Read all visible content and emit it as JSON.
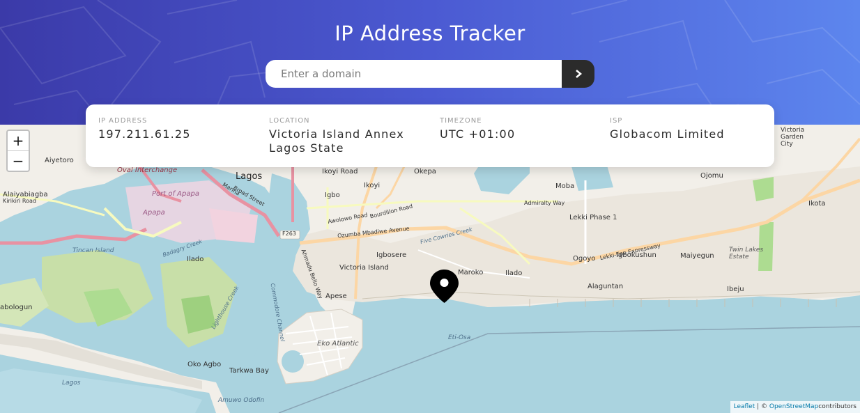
{
  "header": {
    "title": "IP Address Tracker",
    "search_placeholder": "Enter a domain",
    "submit_icon": "chevron-right-icon"
  },
  "info": {
    "ip_label": "IP ADDRESS",
    "ip_value": "197.211.61.25",
    "location_label": "LOCATION",
    "location_line1": "Victoria Island Annex",
    "location_line2": "Lagos State",
    "timezone_label": "TIMEZONE",
    "timezone_value": "UTC +01:00",
    "isp_label": "ISP",
    "isp_value": "Globacom Limited"
  },
  "map": {
    "zoom_in": "+",
    "zoom_out": "−",
    "labels": {
      "lagos": "Lagos",
      "okepa": "Okepa",
      "ikoyi": "Ikoyi",
      "ikoyi2": "Ikoyi",
      "ikoyi_road": "Ikoyi Road",
      "igbo": "Igbo",
      "moba": "Moba",
      "ojomu": "Ojomu",
      "ikota": "Ikota",
      "victoria_garden_city": "Victoria Garden City",
      "aiyetoro": "Aiyetoro",
      "oval_interchange": "Oval Interchange",
      "alaiyabiagba": "Alaiyabiagba",
      "kirikiri_road": "Kirikiri Road",
      "port_of_apapa": "Port of Apapa",
      "apapa": "Apapa",
      "lekki_phase_1": "Lekki Phase 1",
      "twin_lakes_estate": "Twin Lakes Estate",
      "tincan_island": "Tincan Island",
      "ilado": "Ilado",
      "igbosere": "Igbosere",
      "victoria_island": "Victoria Island",
      "maroko": "Maroko",
      "ilado2": "Ilado",
      "ogoyo": "Ogoyo",
      "igbokushun": "Igbokushun",
      "maiyegun": "Maiyegun",
      "alaguntan": "Alaguntan",
      "ibeju": "Ibeju",
      "apese": "Apese",
      "abologun": "abologun",
      "eko_atlantic": "Eko Atlantic",
      "eti_osa": "Eti-Osa",
      "oko_agbo": "Oko Agbo",
      "tarkwa_bay": "Tarkwa Bay",
      "lagos_water": "Lagos",
      "amuwo_odofin": "Amuwo Odofin",
      "f263": "F263",
      "lekki_expressway": "Lekki-Epe Expressway",
      "ozumba": "Ozumba Mbadiwe Avenue",
      "admiralty_way": "Admiralty Way",
      "five_cowries": "Five Cowries Creek",
      "badagry_creek": "Badagry Creek",
      "commodore_channel": "Commodore Channel",
      "lighthouse_creek": "Lighthouse Creek",
      "ahmadu_bello": "Ahmadu Bello Way",
      "bourdillon": "Bourdillon Road",
      "awolowo": "Awolowo Road",
      "broad_street": "Broad Street",
      "marina": "Marina"
    },
    "attribution_leaflet": "Leaflet",
    "attribution_sep": " | © ",
    "attribution_osm": "OpenStreetMap",
    "attribution_rest": "contributors"
  },
  "colors": {
    "header_start": "#3b3aa8",
    "header_end": "#5d86ee",
    "water": "#aad3df",
    "land": "#f2efe9",
    "dark": "#2b2b2b"
  }
}
